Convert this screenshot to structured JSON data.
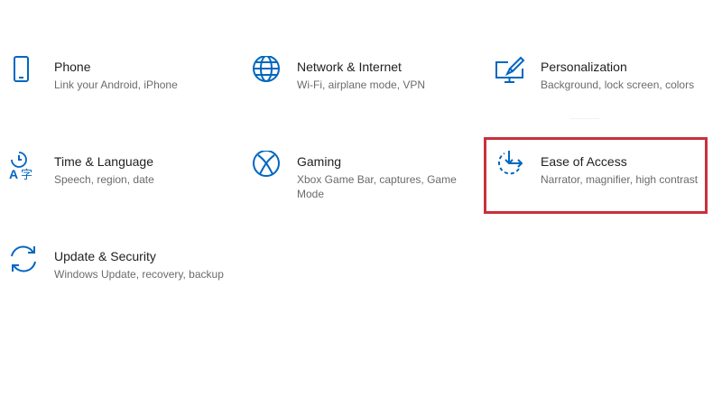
{
  "accent_color": "#0067c0",
  "highlight_color": "#c8313b",
  "tiles": [
    {
      "title": "Phone",
      "desc": "Link your Android, iPhone",
      "icon": "phone-icon"
    },
    {
      "title": "Network & Internet",
      "desc": "Wi-Fi, airplane mode, VPN",
      "icon": "globe-icon"
    },
    {
      "title": "Personalization",
      "desc": "Background, lock screen, colors",
      "icon": "paintbrush-monitor-icon"
    },
    {
      "title": "Time & Language",
      "desc": "Speech, region, date",
      "icon": "time-language-icon"
    },
    {
      "title": "Gaming",
      "desc": "Xbox Game Bar, captures, Game Mode",
      "icon": "xbox-icon"
    },
    {
      "title": "Ease of Access",
      "desc": "Narrator, magnifier, high contrast",
      "icon": "ease-of-access-icon"
    },
    {
      "title": "Update & Security",
      "desc": "Windows Update, recovery, backup",
      "icon": "sync-icon"
    }
  ]
}
